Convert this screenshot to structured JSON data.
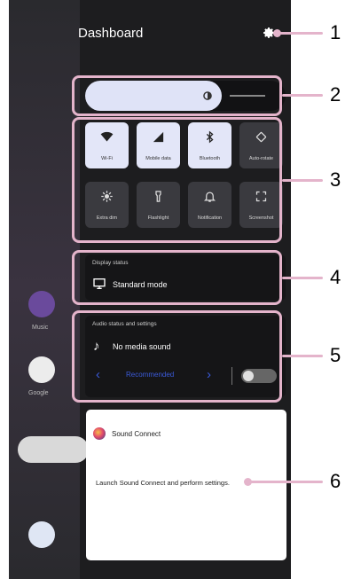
{
  "header": {
    "title": "Dashboard"
  },
  "background_apps": {
    "left_labels": [
      "Music",
      "Google"
    ]
  },
  "brightness": {
    "level": 0.68
  },
  "tiles": [
    {
      "label": "Wi-Fi",
      "icon": "wifi-icon",
      "on": true
    },
    {
      "label": "Mobile data",
      "icon": "signal-icon",
      "on": true
    },
    {
      "label": "Bluetooth",
      "icon": "bluetooth-icon",
      "on": true
    },
    {
      "label": "Auto-rotate",
      "icon": "rotate-icon",
      "on": false
    },
    {
      "label": "Extra dim",
      "icon": "sun-icon",
      "on": false
    },
    {
      "label": "Flashlight",
      "icon": "flashlight-icon",
      "on": false
    },
    {
      "label": "Notification",
      "icon": "bell-icon",
      "on": false
    },
    {
      "label": "Screenshot",
      "icon": "screenshot-icon",
      "on": false
    }
  ],
  "display_status": {
    "header": "Display status",
    "mode": "Standard mode"
  },
  "audio": {
    "header": "Audio status and settings",
    "status": "No media sound",
    "preset": "Recommended",
    "toggle_on": false
  },
  "sound_connect": {
    "app_name": "Sound Connect",
    "description": "Launch Sound Connect and perform settings."
  },
  "callouts": [
    "1",
    "2",
    "3",
    "4",
    "5",
    "6"
  ],
  "colors": {
    "panel": "#151517",
    "highlight": "#e4b4cb",
    "tile_on": "#e3e6f8",
    "accent_blue": "#3b5bdb"
  }
}
